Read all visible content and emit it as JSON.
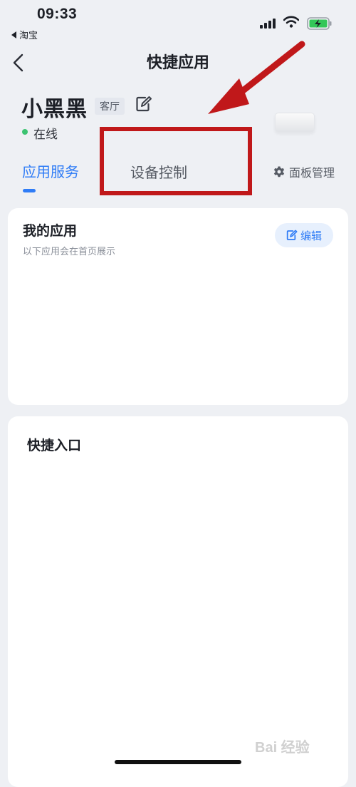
{
  "status_bar": {
    "time": "09:33",
    "back_app": "淘宝"
  },
  "nav": {
    "title": "快捷应用"
  },
  "device": {
    "name": "小黑黑",
    "room": "客厅",
    "status": "在线"
  },
  "tabs": [
    {
      "label": "应用服务",
      "active": true
    },
    {
      "label": "设备控制",
      "active": false
    }
  ],
  "panel_manage": "面板管理",
  "my_apps": {
    "title": "我的应用",
    "subtitle": "以下应用会在首页展示",
    "edit_label": "编辑"
  },
  "quick_entry": {
    "title": "快捷入口"
  },
  "watermark": "Bai 经验",
  "colors": {
    "accent": "#2f7cf6",
    "annotation": "#c0181a",
    "online": "#3cc371",
    "background": "#eef0f4"
  }
}
